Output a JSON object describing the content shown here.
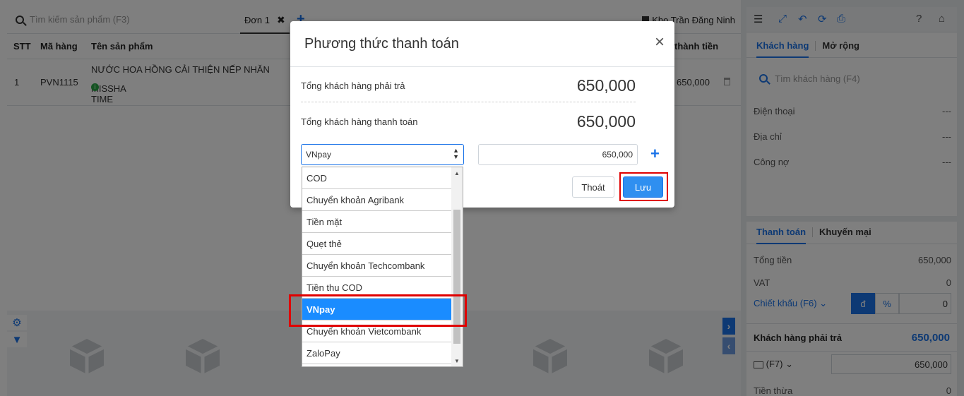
{
  "pos": {
    "search_placeholder": "Tìm kiếm sản phẩm (F3)",
    "tab_label": "Đơn 1",
    "tab_close": "✖",
    "add_tab": "+",
    "store": "Kho Trần Đăng Ninh"
  },
  "table": {
    "headers": {
      "stt": "STT",
      "code": "Mã hàng",
      "name": "Tên sản phẩm",
      "total": "thành tiền"
    },
    "row": {
      "stt": "1",
      "code": "PVN1115",
      "name_line1": "NƯỚC HOA HỒNG CẢI THIỆN NẾP NHĂN",
      "name_line2": "MISSHA TIME",
      "total": "650,000"
    }
  },
  "right": {
    "tabs": {
      "customer": "Khách hàng",
      "more": "Mở rộng"
    },
    "customer_search": "Tìm khách hàng (F4)",
    "phone_label": "Điện thoại",
    "phone_value": "---",
    "address_label": "Địa chỉ",
    "address_value": "---",
    "debt_label": "Công nợ",
    "debt_value": "---",
    "pay_tabs": {
      "pay": "Thanh toán",
      "promo": "Khuyến mại"
    },
    "total_label": "Tổng tiền",
    "total_value": "650,000",
    "vat_label": "VAT",
    "vat_value": "0",
    "discount_label": "Chiết khấu (F6) ⌄",
    "discount_currency": "đ",
    "discount_percent": "%",
    "discount_value": "0",
    "payable_label": "Khách hàng phải trả",
    "payable_value": "650,000",
    "pay_key": "(F7) ⌄",
    "pay_value": "650,000",
    "change_label": "Tiền thừa",
    "change_value": "0"
  },
  "modal": {
    "title": "Phương thức thanh toán",
    "close": "×",
    "must_pay_label": "Tổng khách hàng phải trả",
    "must_pay_value": "650,000",
    "paid_label": "Tổng khách hàng thanh toán",
    "paid_value": "650,000",
    "method_value": "VNpay",
    "amount_value": "650,000",
    "add": "+",
    "cancel": "Thoát",
    "save": "Lưu"
  },
  "dropdown": {
    "options": [
      "COD",
      "Chuyển khoản Agribank",
      "Tiền mặt",
      "Quẹt thẻ",
      "Chuyển khoản Techcombank",
      "Tiền thu COD",
      "VNpay",
      "Chuyển khoản Vietcombank",
      "ZaloPay"
    ],
    "selected": "VNpay"
  },
  "colors": {
    "accent": "#1a73e8",
    "highlight": "#e00000",
    "selected_option": "#1a8cff"
  }
}
